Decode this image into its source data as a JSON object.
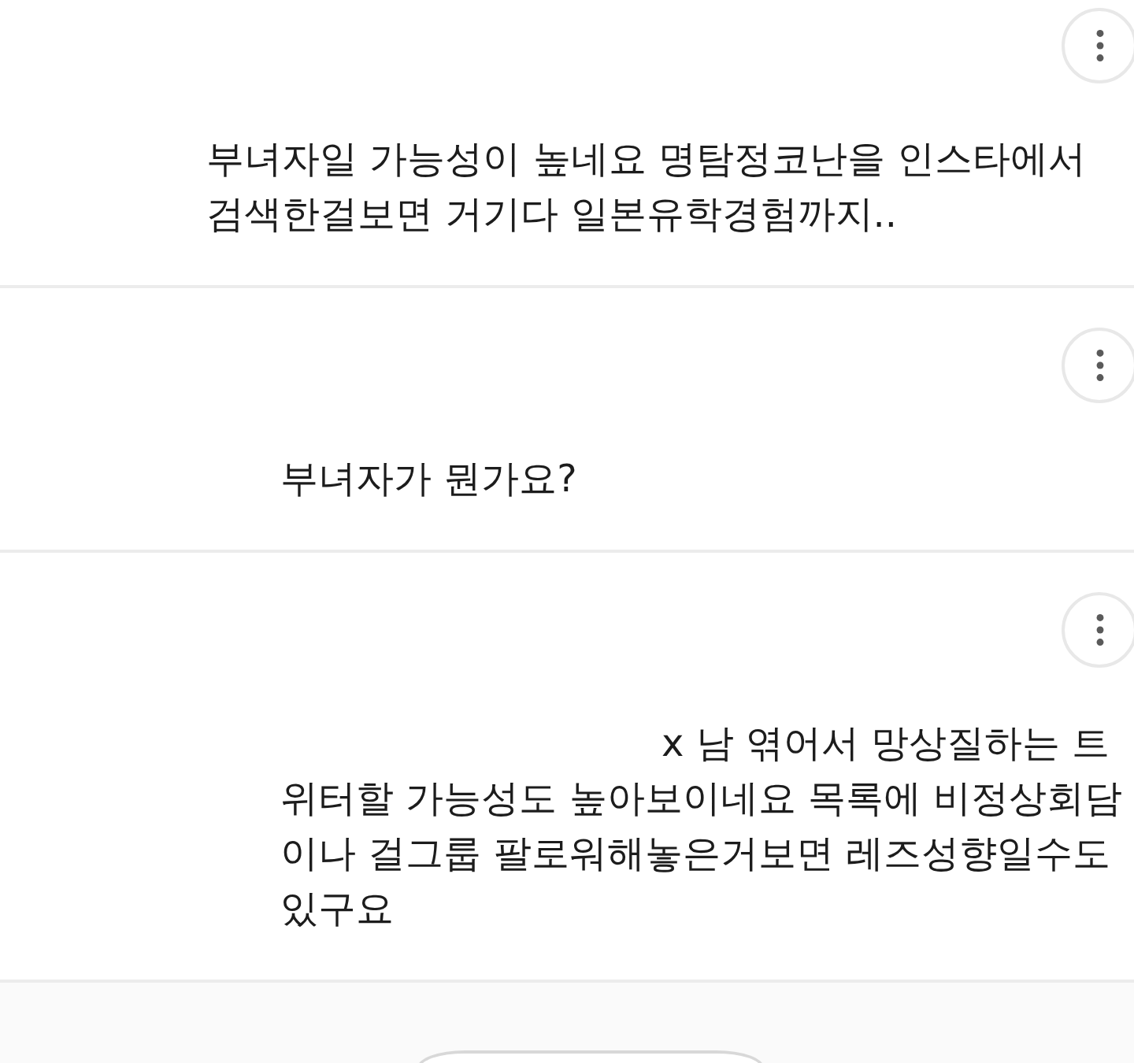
{
  "comments": [
    {
      "lines": [
        "부녀자일 가능성이 높네요 명탐정코난을 인스타에서",
        "검색한걸보면 거기다 일본유학경험까지.."
      ]
    },
    {
      "lines": [
        "부녀자가 뭔가요?"
      ]
    },
    {
      "fragment": "x 남 엮어서 망상질하는 트",
      "lines": [
        "위터할 가능성도 높아보이네요 목록에 비정상회담",
        "이나 걸그룹 팔로워해놓은거보면 레즈성향일수도",
        "있구요"
      ]
    }
  ]
}
